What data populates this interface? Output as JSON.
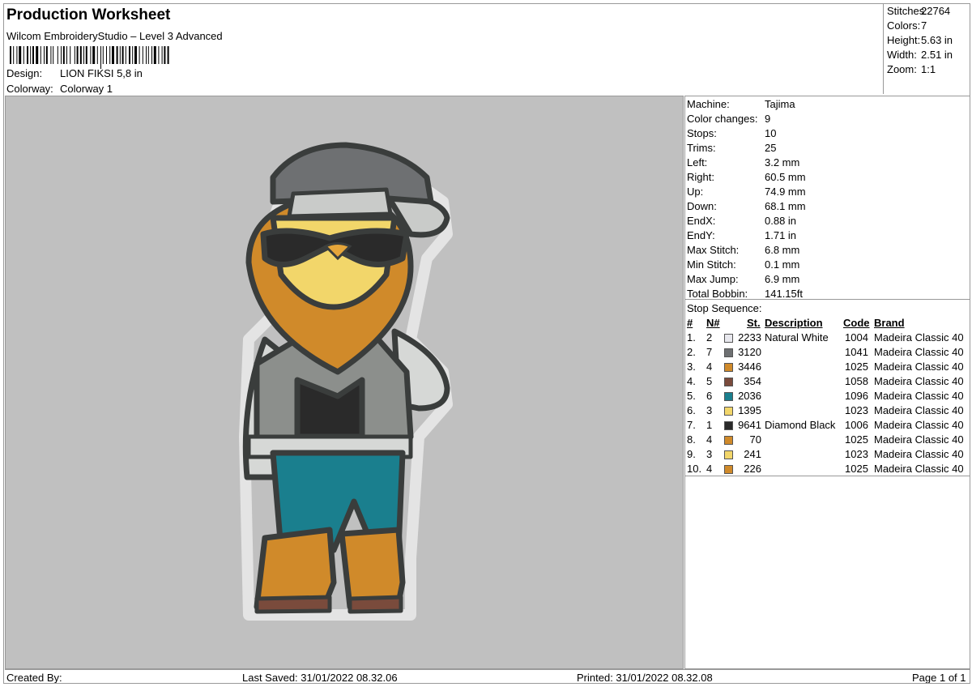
{
  "header": {
    "title": "Production Worksheet",
    "subtitle": "Wilcom EmbroideryStudio – Level 3 Advanced",
    "design_label": "Design:",
    "design_value": "LION FIKSI 5,8 in",
    "colorway_label": "Colorway:",
    "colorway_value": "Colorway 1"
  },
  "stats": [
    {
      "label": "Stitches:",
      "value": "22764"
    },
    {
      "label": "Colors:",
      "value": "7"
    },
    {
      "label": "Height:",
      "value": "5.63 in"
    },
    {
      "label": "Width:",
      "value": "2.51 in"
    },
    {
      "label": "Zoom:",
      "value": "1:1"
    }
  ],
  "machine_info": [
    {
      "label": "Machine:",
      "value": "Tajima"
    },
    {
      "label": "Color changes:",
      "value": "9"
    },
    {
      "label": "Stops:",
      "value": "10"
    },
    {
      "label": "Trims:",
      "value": "25"
    },
    {
      "label": "Left:",
      "value": "3.2 mm"
    },
    {
      "label": "Right:",
      "value": "60.5 mm"
    },
    {
      "label": "Up:",
      "value": "74.9 mm"
    },
    {
      "label": "Down:",
      "value": "68.1 mm"
    },
    {
      "label": "EndX:",
      "value": "0.88 in"
    },
    {
      "label": "EndY:",
      "value": "1.71 in"
    },
    {
      "label": "Max Stitch:",
      "value": "6.8 mm"
    },
    {
      "label": "Min Stitch:",
      "value": "0.1 mm"
    },
    {
      "label": "Max Jump:",
      "value": "6.9 mm"
    },
    {
      "label": "Total Bobbin:",
      "value": "141.15ft"
    }
  ],
  "stop_sequence": {
    "title": "Stop Sequence:",
    "columns": {
      "num": "#",
      "n": "N#",
      "st": "St.",
      "description": "Description",
      "code": "Code",
      "brand": "Brand"
    },
    "rows": [
      {
        "num": "1.",
        "n": "2",
        "color": "#e8e8ee",
        "st": "2233",
        "description": "Natural White",
        "code": "1004",
        "brand": "Madeira Classic 40"
      },
      {
        "num": "2.",
        "n": "7",
        "color": "#6e7072",
        "st": "3120",
        "description": "",
        "code": "1041",
        "brand": "Madeira Classic 40"
      },
      {
        "num": "3.",
        "n": "4",
        "color": "#d08a2a",
        "st": "3446",
        "description": "",
        "code": "1025",
        "brand": "Madeira Classic 40"
      },
      {
        "num": "4.",
        "n": "5",
        "color": "#7a4b3c",
        "st": "354",
        "description": "",
        "code": "1058",
        "brand": "Madeira Classic 40"
      },
      {
        "num": "5.",
        "n": "6",
        "color": "#1a7f8e",
        "st": "2036",
        "description": "",
        "code": "1096",
        "brand": "Madeira Classic 40"
      },
      {
        "num": "6.",
        "n": "3",
        "color": "#f2d66a",
        "st": "1395",
        "description": "",
        "code": "1023",
        "brand": "Madeira Classic 40"
      },
      {
        "num": "7.",
        "n": "1",
        "color": "#2a2a2a",
        "st": "9641",
        "description": "Diamond Black",
        "code": "1006",
        "brand": "Madeira Classic 40"
      },
      {
        "num": "8.",
        "n": "4",
        "color": "#d08a2a",
        "st": "70",
        "description": "",
        "code": "1025",
        "brand": "Madeira Classic 40"
      },
      {
        "num": "9.",
        "n": "3",
        "color": "#f2d66a",
        "st": "241",
        "description": "",
        "code": "1023",
        "brand": "Madeira Classic 40"
      },
      {
        "num": "10.",
        "n": "4",
        "color": "#d08a2a",
        "st": "226",
        "description": "",
        "code": "1025",
        "brand": "Madeira Classic 40"
      }
    ]
  },
  "footer": {
    "created_by": "Created By:",
    "last_saved": "Last Saved: 31/01/2022 08.32.06",
    "printed": "Printed: 31/01/2022 08.32.08",
    "page": "Page 1 of 1"
  },
  "colors": {
    "preview_bg": "#c0c0c0",
    "outline": "#3a3d3c",
    "cap": "#6e7072",
    "cap_brim": "#c9cbc9",
    "face": "#f2d66a",
    "mane": "#d08a2a",
    "hoodie": "#d6d8d6",
    "jacket": "#8c8f8c",
    "shirt": "#2a2a2a",
    "jeans": "#1a7f8e",
    "boots": "#d08a2a",
    "soles": "#7a4b3c"
  },
  "illustration": {
    "subject": "lion-character-embroidery-icon"
  }
}
